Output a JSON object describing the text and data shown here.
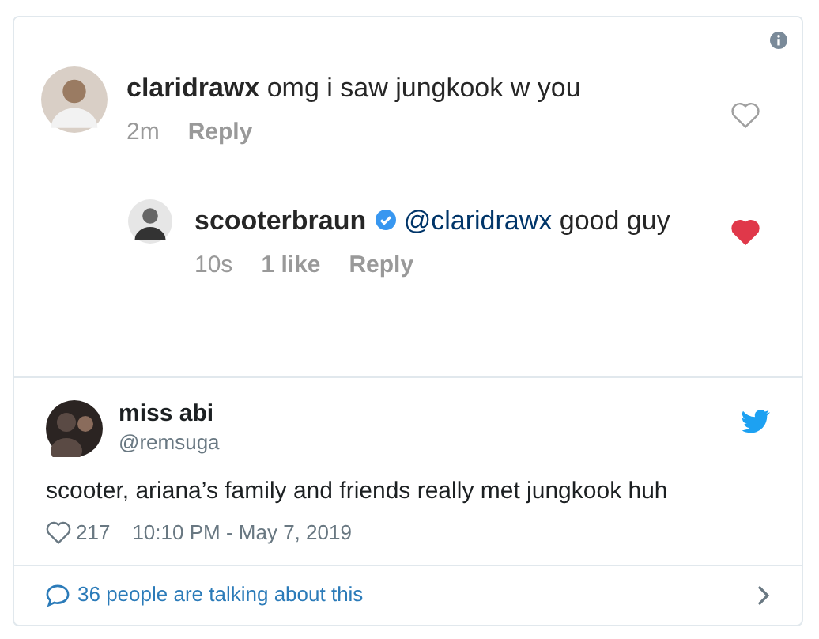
{
  "embedded_image": {
    "comments": [
      {
        "username": "claridrawx",
        "verified": false,
        "text": "omg i saw jungkook w you",
        "time": "2m",
        "reply": "Reply",
        "liked": false,
        "children": [
          {
            "username": "scooterbraun",
            "verified": true,
            "mention": "@claridrawx",
            "text": "good guy",
            "time": "10s",
            "likes": "1 like",
            "reply": "Reply",
            "liked": true
          }
        ]
      }
    ]
  },
  "tweet": {
    "name": "miss abi",
    "handle": "@remsuga",
    "text": "scooter, ariana’s family and friends really met jungkook huh",
    "likes": "217",
    "timestamp": "10:10 PM - May 7, 2019"
  },
  "footer": {
    "text": "36 people are talking about this"
  }
}
